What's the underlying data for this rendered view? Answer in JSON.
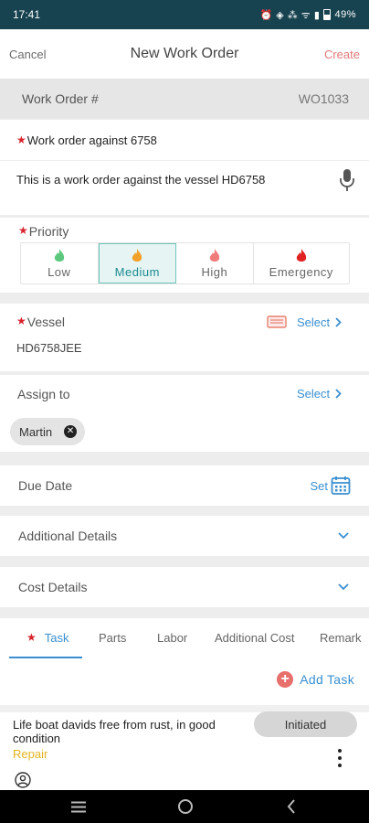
{
  "status_bar": {
    "time": "17:41",
    "icons_text": "⏰ ◈ ⁂ ᯤ ▮",
    "battery": "49%"
  },
  "nav": {
    "cancel": "Cancel",
    "title": "New Work Order",
    "create": "Create"
  },
  "work_order": {
    "label": "Work Order #",
    "number": "WO1033"
  },
  "title_field": {
    "label": "Work order against 6758",
    "value": "This is a work order against the vessel HD6758"
  },
  "priority": {
    "label": "Priority",
    "options": [
      {
        "label": "Low",
        "color": "#5cc77d"
      },
      {
        "label": "Medium",
        "color": "#f3a12a"
      },
      {
        "label": "High",
        "color": "#f07b7b"
      },
      {
        "label": "Emergency",
        "color": "#e02222"
      }
    ],
    "selected": "Medium"
  },
  "vessel": {
    "label": "Vessel",
    "select": "Select",
    "value": "HD6758JEE"
  },
  "assign": {
    "label": "Assign to",
    "select": "Select",
    "assignee": "Martin"
  },
  "due_date": {
    "label": "Due Date",
    "action": "Set"
  },
  "additional_details": {
    "label": "Additional Details"
  },
  "cost_details": {
    "label": "Cost Details"
  },
  "tabs": [
    "Task",
    "Parts",
    "Labor",
    "Additional Cost",
    "Remark"
  ],
  "active_tab": "Task",
  "add_task": "Add Task",
  "task": {
    "title": "Life boat davids free from rust, in good condition",
    "type": "Repair",
    "status": "Initiated"
  },
  "colors": {
    "accent": "#3a8fd0",
    "required": "#d9232e",
    "create": "#e07a78",
    "statusbar": "#17424f"
  }
}
